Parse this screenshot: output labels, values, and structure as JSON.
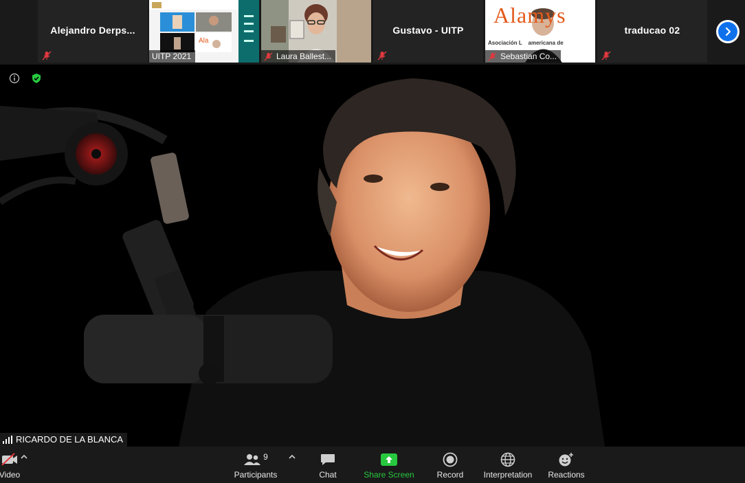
{
  "strip": {
    "tiles": [
      {
        "name": "Alejandro  Derps..."
      },
      {
        "name": "UITP 2021"
      },
      {
        "name": "Laura Ballest..."
      },
      {
        "name": "Gustavo - UITP"
      },
      {
        "name": "Sebastian Co..."
      },
      {
        "name": "traducao 02"
      }
    ],
    "alamys_logo": "Alamys",
    "alamys_caption": "Asociación L    americana de",
    "next_icon": "chevron-right-icon"
  },
  "speaker": {
    "name": "RICARDO DE LA BLANCA"
  },
  "toolbar": {
    "video_label": "Video",
    "participants_label": "Participants",
    "participants_count": "9",
    "chat_label": "Chat",
    "share_label": "Share Screen",
    "record_label": "Record",
    "interpretation_label": "Interpretation",
    "reactions_label": "Reactions"
  },
  "colors": {
    "accent_blue": "#0e71eb",
    "share_green": "#27c93f",
    "mute_red": "#e0393e",
    "toolbar_bg": "#1a1a1a"
  }
}
